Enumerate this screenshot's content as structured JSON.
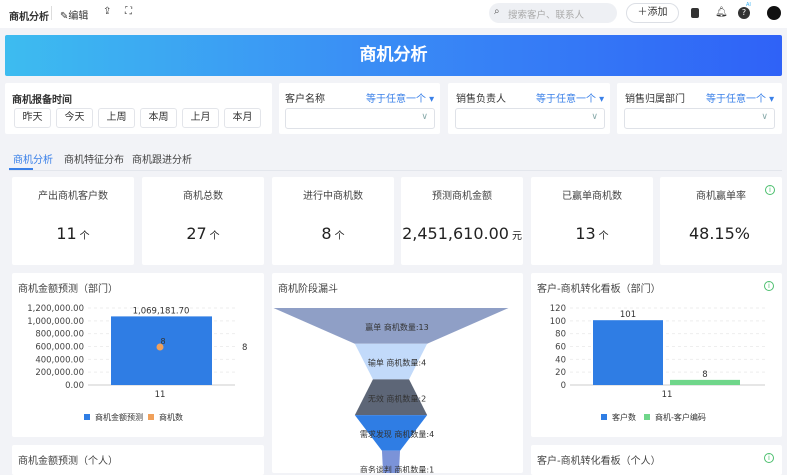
{
  "header": {
    "title": "商机分析",
    "edit": "编辑",
    "search_placeholder": "搜索客户、联系人",
    "add": "添加",
    "ai_badge": "AI"
  },
  "banner": {
    "title": "商机分析"
  },
  "filters": {
    "time": {
      "label": "商机报备时间",
      "buttons": [
        "昨天",
        "今天",
        "上周",
        "本周",
        "上月",
        "本月"
      ]
    },
    "fields": [
      {
        "label": "客户名称",
        "op": "等于任意一个"
      },
      {
        "label": "销售负责人",
        "op": "等于任意一个"
      },
      {
        "label": "销售归属部门",
        "op": "等于任意一个"
      }
    ]
  },
  "tabs": [
    {
      "label": "商机分析",
      "active": true
    },
    {
      "label": "商机特征分布"
    },
    {
      "label": "商机跟进分析"
    }
  ],
  "kpis": [
    {
      "title": "产出商机客户数",
      "value": "11",
      "unit": "个"
    },
    {
      "title": "商机总数",
      "value": "27",
      "unit": "个"
    },
    {
      "title": "进行中商机数",
      "value": "8",
      "unit": "个"
    },
    {
      "title": "预测商机金额",
      "value": "2,451,610.00",
      "unit": "元"
    },
    {
      "title": "已赢单商机数",
      "value": "13",
      "unit": "个"
    },
    {
      "title": "商机赢单率",
      "value": "48.15%",
      "unit": ""
    }
  ],
  "colors": {
    "accent": "#3a80e8",
    "blue": "#2f7de4",
    "orange": "#f0a05a",
    "green": "#6fd68a"
  },
  "chart_data": [
    {
      "type": "bar",
      "title": "商机金额预测（部门）",
      "categories": [
        "11"
      ],
      "series": [
        {
          "name": "商机金额预测",
          "values": [
            1069181.7
          ],
          "labels": [
            "1,069,181.70"
          ]
        },
        {
          "name": "商机数",
          "values": [
            8
          ],
          "axis": "right",
          "render": "point"
        }
      ],
      "yticks": [
        "1,200,000.00",
        "1,000,000.00",
        "800,000.00",
        "600,000.00",
        "400,000.00",
        "200,000.00",
        "0.00"
      ],
      "ylim": [
        0,
        1200000
      ],
      "y2_label": "8",
      "legend": "bottom"
    },
    {
      "type": "funnel",
      "title": "商机阶段漏斗",
      "stages": [
        {
          "label": "赢单 商机数量:13",
          "value": 13,
          "color": "#8f9fc6"
        },
        {
          "label": "输单 商机数量:4",
          "value": 4,
          "color": "#c2dafa"
        },
        {
          "label": "无效 商机数量:2",
          "value": 2,
          "color": "#5d6677"
        },
        {
          "label": "需求发现 商机数量:4",
          "value": 4,
          "color": "#2f7de4"
        },
        {
          "label": "商务谈判 商机数量:1",
          "value": 1,
          "color": "#7b93d8"
        }
      ]
    },
    {
      "type": "bar",
      "title": "客户-商机转化看板（部门）",
      "categories": [
        "11"
      ],
      "series": [
        {
          "name": "客户数",
          "values": [
            101
          ]
        },
        {
          "name": "商机-客户编码",
          "values": [
            8
          ]
        }
      ],
      "yticks": [
        "120",
        "100",
        "80",
        "60",
        "40",
        "20",
        "0"
      ],
      "ylim": [
        0,
        120
      ],
      "legend": "bottom"
    }
  ],
  "lower": {
    "left_title": "商机金额预测（个人）",
    "right_title": "客户-商机转化看板（个人）"
  }
}
